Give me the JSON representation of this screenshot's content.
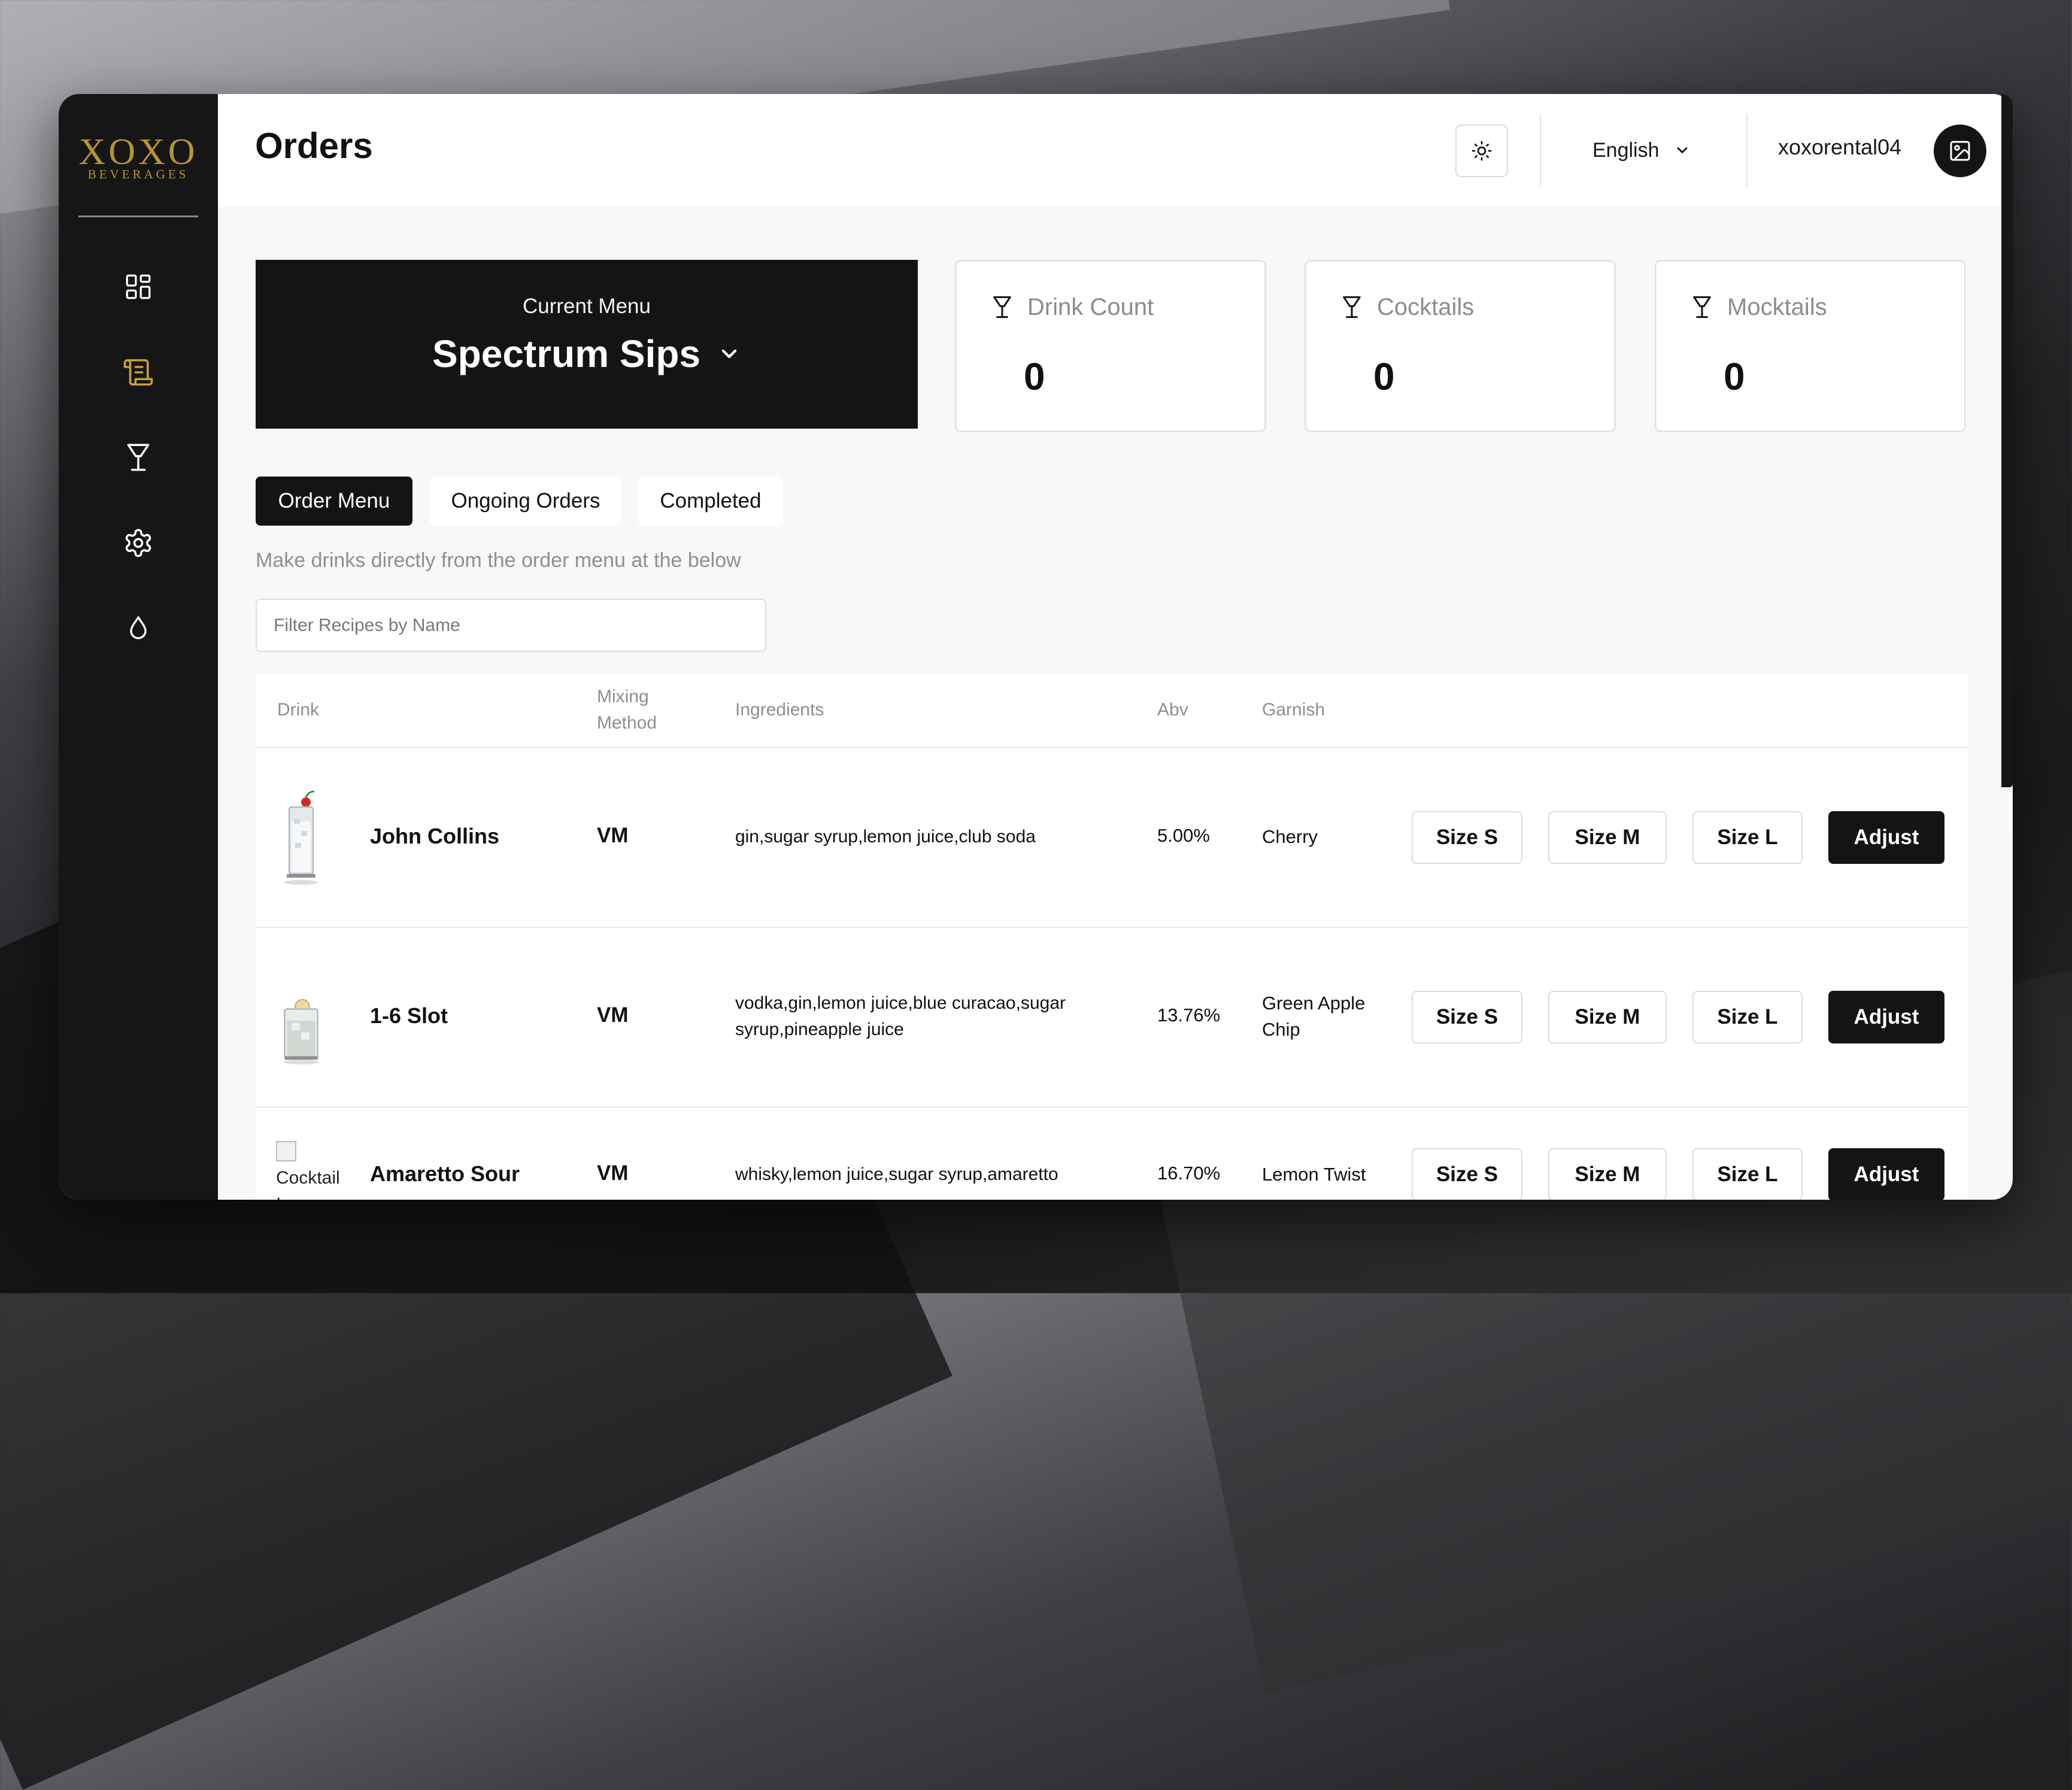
{
  "brand": {
    "logo_top": "XOXO",
    "logo_bottom": "BEVERAGES"
  },
  "sidebar": {
    "items": [
      {
        "name": "dashboard",
        "icon": "grid-icon",
        "active": false
      },
      {
        "name": "orders",
        "icon": "scroll-icon",
        "active": true
      },
      {
        "name": "drinks",
        "icon": "cocktail-glass-icon",
        "active": false
      },
      {
        "name": "settings",
        "icon": "gear-icon",
        "active": false
      },
      {
        "name": "ingredients",
        "icon": "drop-icon",
        "active": false
      }
    ]
  },
  "header": {
    "title": "Orders",
    "theme_icon": "sun-icon",
    "language": "English",
    "username": "xoxorental04",
    "avatar_icon": "image-icon"
  },
  "current_menu": {
    "label": "Current Menu",
    "value": "Spectrum Sips"
  },
  "stats": [
    {
      "label": "Drink Count",
      "value": "0",
      "icon": "cocktail-glass-icon"
    },
    {
      "label": "Cocktails",
      "value": "0",
      "icon": "cocktail-glass-icon"
    },
    {
      "label": "Mocktails",
      "value": "0",
      "icon": "cocktail-glass-icon"
    }
  ],
  "tabs": [
    {
      "label": "Order Menu",
      "active": true
    },
    {
      "label": "Ongoing Orders",
      "active": false
    },
    {
      "label": "Completed",
      "active": false
    }
  ],
  "hint": "Make drinks directly from the order menu at the below",
  "filter": {
    "placeholder": "Filter Recipes by Name",
    "value": ""
  },
  "table": {
    "headers": {
      "drink": "Drink",
      "mixing_line1": "Mixing",
      "mixing_line2": "Method",
      "ingredients": "Ingredients",
      "abv": "Abv",
      "garnish": "Garnish"
    },
    "rows": [
      {
        "name": "John Collins",
        "image": "highball-glass",
        "method": "VM",
        "ingredients": "gin,sugar syrup,lemon juice,club soda",
        "abv": "5.00%",
        "garnish": "Cherry",
        "size_s": "Size S",
        "size_m": "Size M",
        "size_l": "Size L",
        "adjust": "Adjust"
      },
      {
        "name": "1-6 Slot",
        "image": "rocks-glass",
        "method": "VM",
        "ingredients": "vodka,gin,lemon juice,blue curacao,sugar syrup,pineapple juice",
        "abv": "13.76%",
        "garnish": "Green Apple Chip",
        "size_s": "Size S",
        "size_m": "Size M",
        "size_l": "Size L",
        "adjust": "Adjust"
      },
      {
        "name": "Amaretto Sour",
        "image_alt": "Cocktail Image",
        "method": "VM",
        "ingredients": "whisky,lemon juice,sugar syrup,amaretto",
        "abv": "16.70%",
        "garnish": "Lemon Twist",
        "size_s": "Size S",
        "size_m": "Size M",
        "size_l": "Size L",
        "adjust": "Adjust"
      }
    ]
  },
  "colors": {
    "accent_gold": "#b8942f",
    "sidebar_bg": "#161617",
    "dark_button": "#141414"
  }
}
